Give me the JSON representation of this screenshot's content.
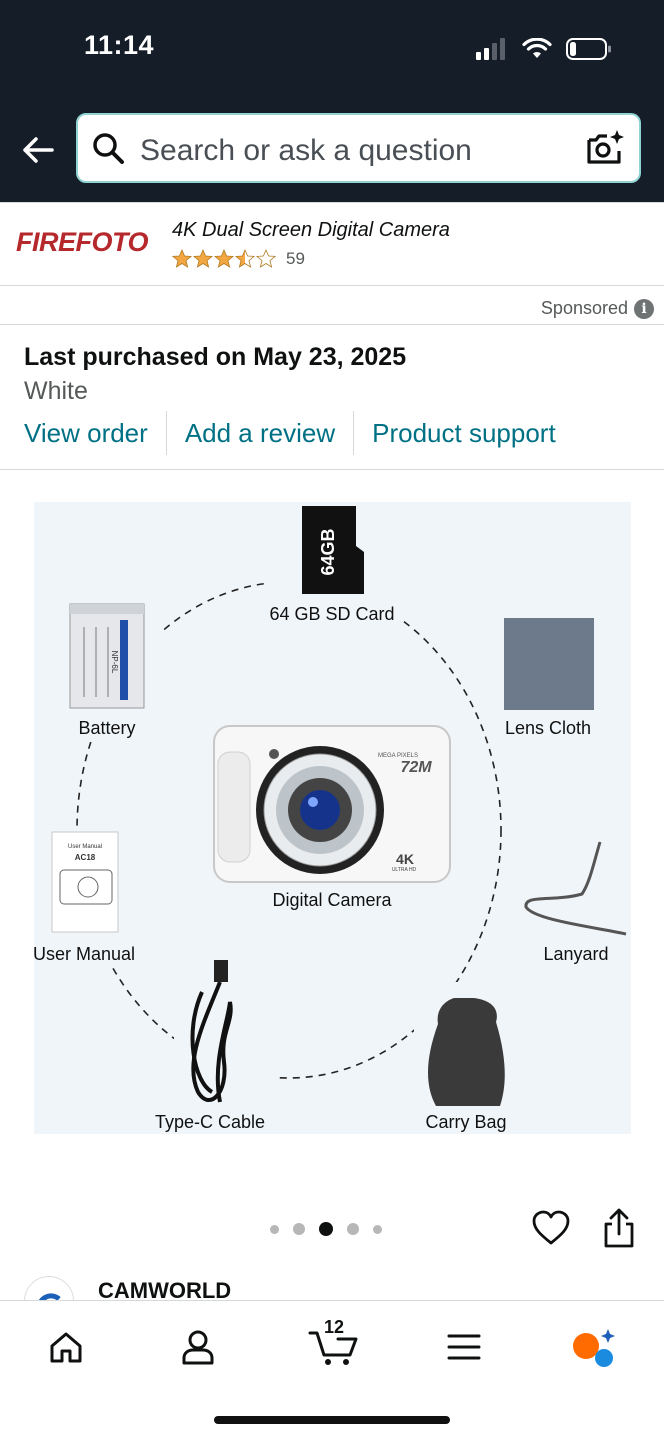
{
  "status_bar": {
    "time": "11:14"
  },
  "search": {
    "placeholder": "Search or ask a question"
  },
  "ad": {
    "brand": "FIREFOTO",
    "title": "4K Dual Screen Digital Camera",
    "rating": 4.5,
    "rating_count": "59",
    "sponsored_label": "Sponsored",
    "info_glyph": "i"
  },
  "purchase": {
    "heading": "Last purchased on May 23, 2025",
    "variant": "White",
    "links": [
      "View order",
      "Add a review",
      "Product support"
    ]
  },
  "product_image": {
    "labels": {
      "sd_card": "64 GB SD Card",
      "battery": "Battery",
      "lens_cloth": "Lens Cloth",
      "camera": "Digital Camera",
      "manual": "User Manual",
      "lanyard": "Lanyard",
      "cable": "Type-C Cable",
      "bag": "Carry Bag"
    },
    "sd_text": "64GB",
    "camera_text": {
      "mp": "72M",
      "mp_small": "MEGA PIXELS",
      "res": "4K",
      "res_small": "ULTRA HD"
    },
    "manual_text": {
      "title": "User Manual",
      "model": "AC18"
    },
    "battery_text": "NP-6L"
  },
  "carousel": {
    "count": 5,
    "active_index": 2
  },
  "seller": {
    "name": "CAMWORLD"
  },
  "nav": {
    "cart_count": "12"
  },
  "colors": {
    "header_bg": "#151d28",
    "link": "#007185",
    "star": "#f2a742",
    "brand": "#b5282b",
    "rufus_orange": "#ff6b00",
    "rufus_blue": "#1b8be0"
  }
}
